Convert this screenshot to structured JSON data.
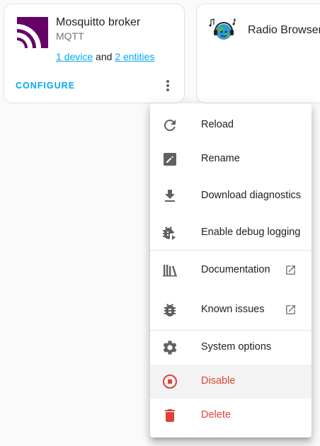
{
  "cards": {
    "mqtt": {
      "title": "Mosquitto broker",
      "subtitle": "MQTT",
      "devices_link": "1 device",
      "and_text": "and",
      "entities_link": "2 entities",
      "configure_label": "CONFIGURE",
      "logo_icon": "mqtt-logo-icon",
      "menu_icon": "dots-vertical-icon"
    },
    "radio": {
      "title": "Radio Browser",
      "logo_icon": "radio-browser-logo-icon"
    }
  },
  "menu": {
    "items": [
      {
        "label": "Reload",
        "icon": "reload-icon"
      },
      {
        "label": "Rename",
        "icon": "rename-icon"
      },
      {
        "label": "Download diagnostics",
        "icon": "download-icon"
      },
      {
        "label": "Enable debug logging",
        "icon": "bug-play-icon"
      },
      {
        "label": "Documentation",
        "icon": "book-icon",
        "external": true
      },
      {
        "label": "Known issues",
        "icon": "bug-icon",
        "external": true
      },
      {
        "label": "System options",
        "icon": "gear-icon"
      },
      {
        "label": "Disable",
        "icon": "stop-circle-icon",
        "danger": true
      },
      {
        "label": "Delete",
        "icon": "delete-icon",
        "danger": true
      }
    ]
  },
  "colors": {
    "accent": "#03a9f4",
    "danger": "#db4437",
    "mqtt_brand": "#660066",
    "icon": "#616161"
  }
}
